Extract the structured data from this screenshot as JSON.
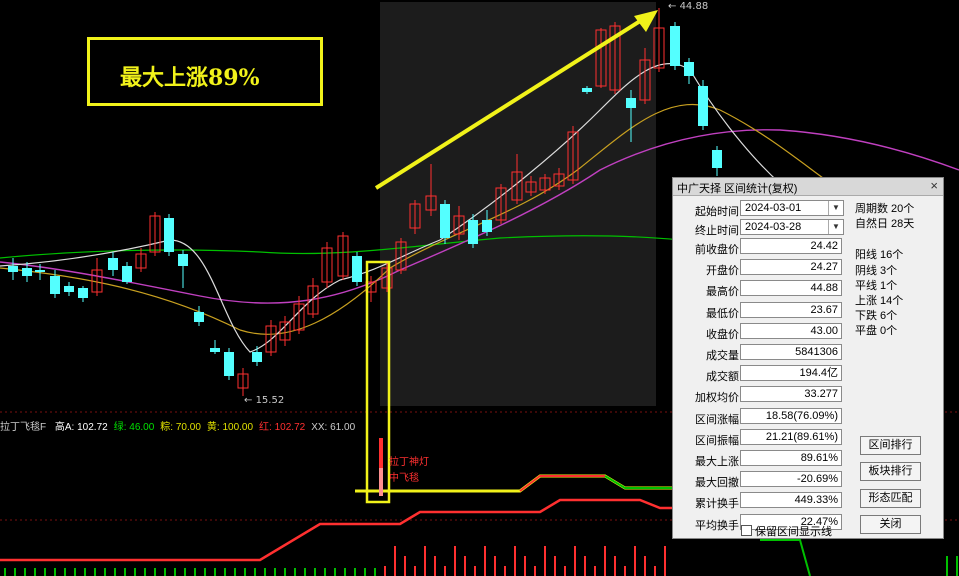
{
  "annotation": {
    "text": "最大上涨89%"
  },
  "price_labels": {
    "high": "44.88",
    "low": "15.52"
  },
  "indicator_row": {
    "name": "拉丁飞毯F",
    "items": [
      {
        "label": "高A: 102.72",
        "color": "#ffffff"
      },
      {
        "label": "绿: 46.00",
        "color": "#00e000"
      },
      {
        "label": "粽: 70.00",
        "color": "#e0e000"
      },
      {
        "label": "黄: 100.00",
        "color": "#e0e000"
      },
      {
        "label": "红: 102.72",
        "color": "#ff3030"
      },
      {
        "label": "XX: 61.00",
        "color": "#cccccc"
      }
    ]
  },
  "signals": {
    "line1": "拉丁神灯",
    "line2": "中飞毯"
  },
  "dialog": {
    "title": "中广天择 区间统计(复权)",
    "start_label": "起始时间",
    "start_value": "2024-03-01",
    "end_label": "终止时间",
    "end_value": "2024-03-28",
    "rows": [
      {
        "label": "前收盘价",
        "value": "24.42"
      },
      {
        "label": "开盘价",
        "value": "24.27"
      },
      {
        "label": "最高价",
        "value": "44.88"
      },
      {
        "label": "最低价",
        "value": "23.67"
      },
      {
        "label": "收盘价",
        "value": "43.00"
      },
      {
        "label": "成交量",
        "value": "5841306"
      },
      {
        "label": "成交额",
        "value": "194.4亿"
      },
      {
        "label": "加权均价",
        "value": "33.277"
      },
      {
        "label": "区间涨幅",
        "value": "18.58(76.09%)"
      },
      {
        "label": "区间振幅",
        "value": "21.21(89.61%)"
      },
      {
        "label": "最大上涨",
        "value": "89.61%"
      },
      {
        "label": "最大回撤",
        "value": "-20.69%"
      },
      {
        "label": "累计换手",
        "value": "449.33%"
      },
      {
        "label": "平均换手",
        "value": "22.47%"
      }
    ],
    "stats": [
      "周期数 20个",
      "自然日 28天",
      "阳线 16个",
      "阴线 3个",
      "平线 1个",
      "上涨 14个",
      "下跌 6个",
      "平盘 0个"
    ],
    "buttons": [
      "区间排行",
      "板块排行",
      "形态匹配",
      "关闭"
    ],
    "checkbox_label": "保留区间显示线",
    "close_glyph": "×"
  }
}
